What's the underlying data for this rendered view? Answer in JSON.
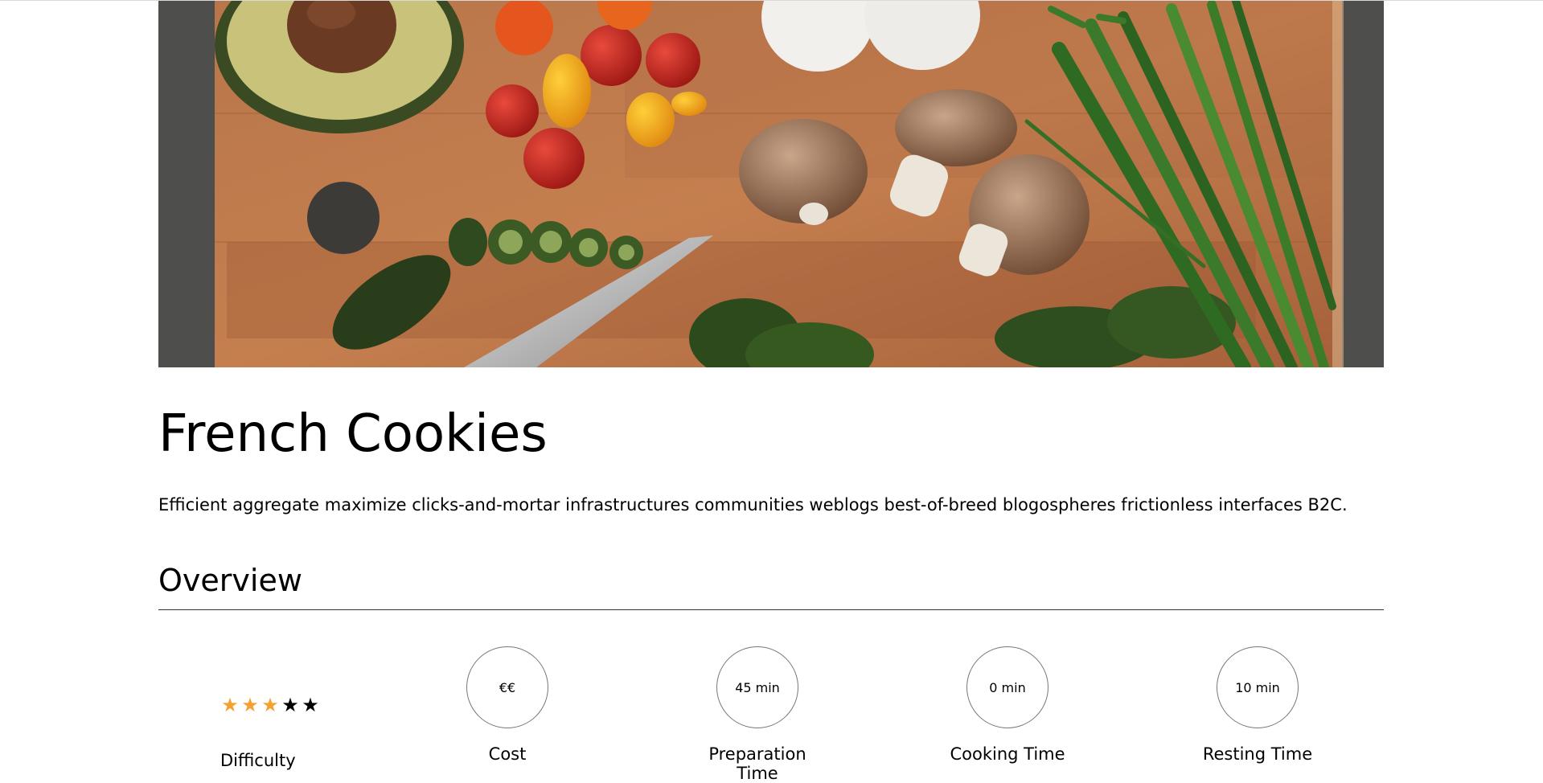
{
  "recipe": {
    "title": "French Cookies",
    "description": "Efficient aggregate maximize clicks-and-mortar infrastructures communities weblogs best-of-breed blogospheres frictionless interfaces B2C.",
    "hero_image_alt": "Vegetables on a cutting board"
  },
  "overview": {
    "heading": "Overview",
    "difficulty": {
      "label": "Difficulty",
      "rating": 3,
      "max": 5,
      "icon": "star-icon",
      "on_color": "#f5a031",
      "off_color": "#000000"
    },
    "cost": {
      "value": "€€",
      "label": "Cost"
    },
    "preparation": {
      "value": "45 min",
      "label": "Preparation Time"
    },
    "cooking": {
      "value": "0 min",
      "label": "Cooking Time"
    },
    "resting": {
      "value": "10 min",
      "label": "Resting Time"
    }
  }
}
